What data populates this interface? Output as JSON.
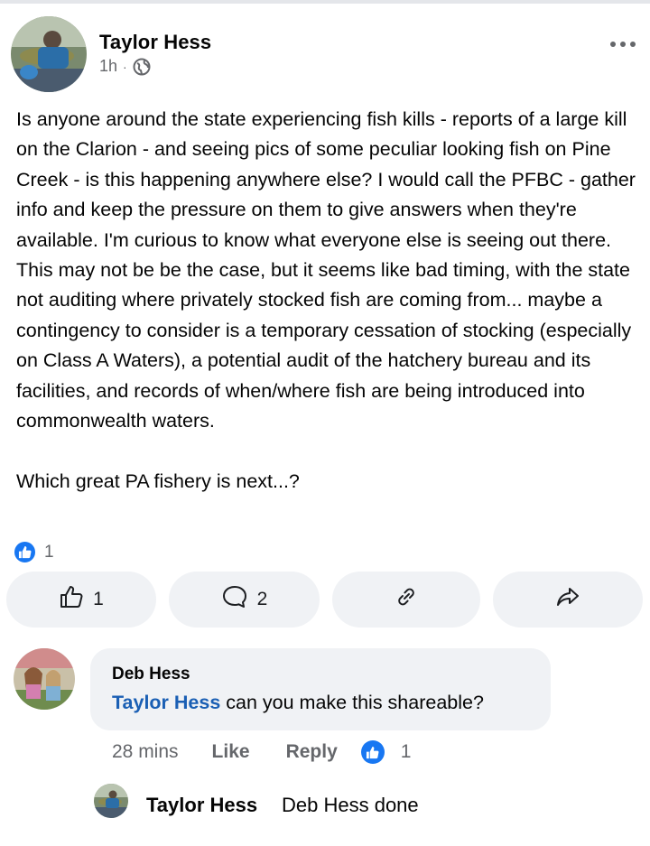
{
  "post": {
    "author": "Taylor Hess",
    "time": "1h",
    "separator": "·",
    "privacy_icon": "globe-icon",
    "more_icon": "more-options-icon",
    "text": "Is anyone around the state experiencing fish kills - reports of a large kill on the Clarion - and seeing pics of some peculiar looking fish on Pine Creek - is this happening anywhere else? I would call the PFBC - gather info and keep the pressure on them to give answers when they're available. I'm curious to know what everyone else is seeing out there. This may not be be the case, but it seems like bad timing, with the state not auditing where privately stocked fish are coming from... maybe a contingency to consider is a temporary cessation of stocking (especially on Class A Waters), a potential audit of the hatchery bureau and its facilities, and records of when/where fish are being introduced into commonwealth waters.\n\nWhich great PA fishery is next...?",
    "reaction_count": "1"
  },
  "actions": {
    "like_count": "1",
    "comment_count": "2",
    "like_icon": "thumbs-up-icon",
    "comment_icon": "comment-icon",
    "link_icon": "link-icon",
    "share_icon": "share-icon"
  },
  "comment": {
    "author": "Deb Hess",
    "mention": "Taylor Hess",
    "text": " can you make this shareable?",
    "time": "28 mins",
    "like_label": "Like",
    "reply_label": "Reply",
    "reaction_count": "1"
  },
  "reply": {
    "author": "Taylor Hess",
    "text": "Deb Hess done"
  },
  "colors": {
    "accent": "#1877f2",
    "mention": "#1a5fb4",
    "muted": "#65676b",
    "button_bg": "#f0f2f5"
  }
}
